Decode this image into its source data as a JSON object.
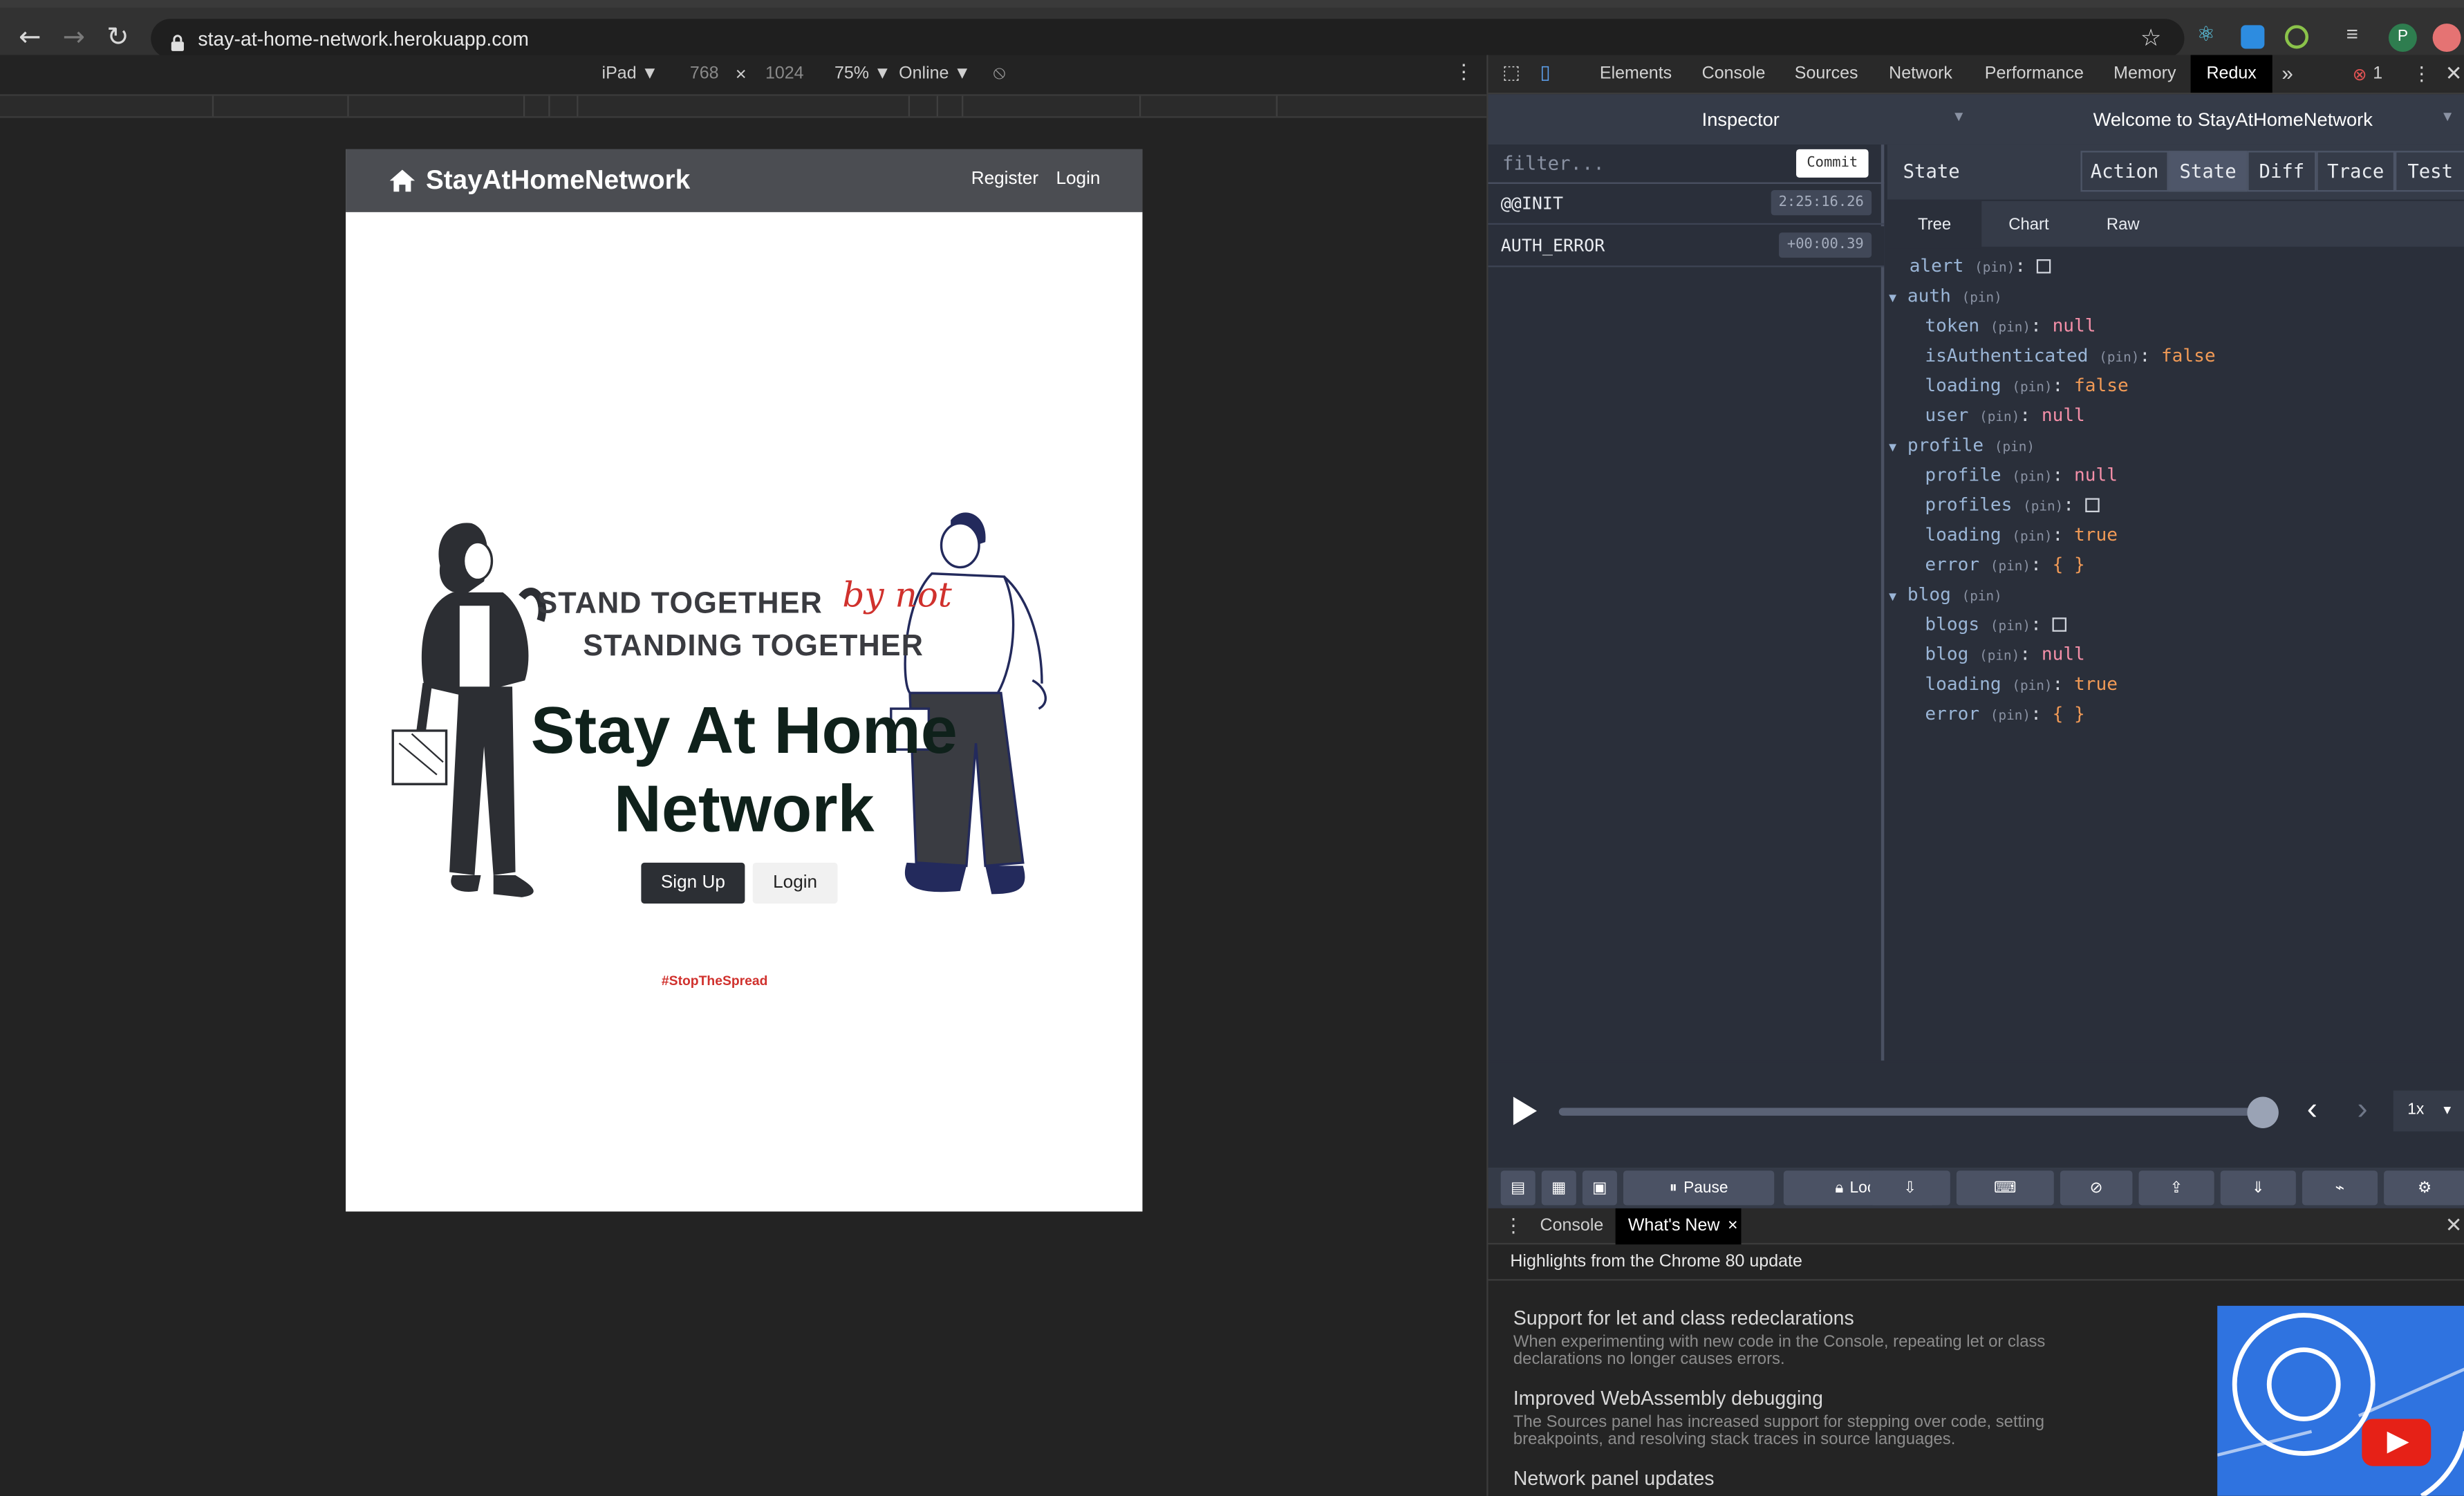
{
  "browser": {
    "url": "stay-at-home-network.herokuapp.com",
    "back_icon": "←",
    "forward_icon": "→",
    "reload_icon": "↻"
  },
  "device_toolbar": {
    "device": "iPad ▼",
    "width": "768",
    "times": "×",
    "height": "1024",
    "zoom": "75% ▼",
    "network": "Online ▼"
  },
  "site": {
    "brand": "StayAtHomeNetwork",
    "nav": [
      "Register",
      "Login"
    ],
    "headline1": "STAND TOGETHER",
    "byline": "by not",
    "headline2": "STANDING TOGETHER",
    "title": "Stay At Home Network",
    "signup": "Sign Up",
    "login": "Login",
    "hashtag": "#StopTheSpread"
  },
  "devtools": {
    "tabs": [
      "Elements",
      "Console",
      "Sources",
      "Network",
      "Performance",
      "Memory",
      "Redux"
    ],
    "more": "»",
    "errors": "1",
    "redux": {
      "inspector": "Inspector",
      "instance": "Welcome to StayAtHomeNetwork",
      "filter_placeholder": "filter...",
      "commit": "Commit",
      "actions": [
        {
          "name": "@@INIT",
          "time": "2:25:16.26"
        },
        {
          "name": "AUTH_ERROR",
          "time": "+00:00.39"
        }
      ],
      "state_label": "State",
      "segments": [
        "Action",
        "State",
        "Diff",
        "Trace",
        "Test"
      ],
      "subtabs": [
        "Tree",
        "Chart",
        "Raw"
      ],
      "pin": "(pin)",
      "tree": {
        "alert": "alert",
        "auth": "auth",
        "token": "token",
        "token_v": "null",
        "isAuthenticated": "isAuthenticated",
        "isAuthenticated_v": "false",
        "loading1": "loading",
        "loading1_v": "false",
        "user": "user",
        "user_v": "null",
        "profile": "profile",
        "profile_k": "profile",
        "profile_v": "null",
        "profiles": "profiles",
        "loading2": "loading",
        "loading2_v": "true",
        "error1": "error",
        "error1_v": "{ }",
        "blog": "blog",
        "blogs": "blogs",
        "blog_k": "blog",
        "blog_v": "null",
        "loading3": "loading",
        "loading3_v": "true",
        "error2": "error",
        "error2_v": "{ }"
      },
      "playback_speed": "1x",
      "slider_value": 1.0,
      "buttons": [
        "Pause",
        "Lock"
      ]
    },
    "drawer": {
      "tabs": [
        "Console",
        "What's New"
      ],
      "close": "×",
      "highlight": "Highlights from the Chrome 80 update",
      "items": [
        {
          "title": "Support for let and class redeclarations",
          "desc": "When experimenting with new code in the Console, repeating let or class declarations no longer causes errors."
        },
        {
          "title": "Improved WebAssembly debugging",
          "desc": "The Sources panel has increased support for stepping over code, setting breakpoints, and resolving stack traces in source languages."
        },
        {
          "title": "Network panel updates",
          "desc": ""
        }
      ]
    }
  }
}
